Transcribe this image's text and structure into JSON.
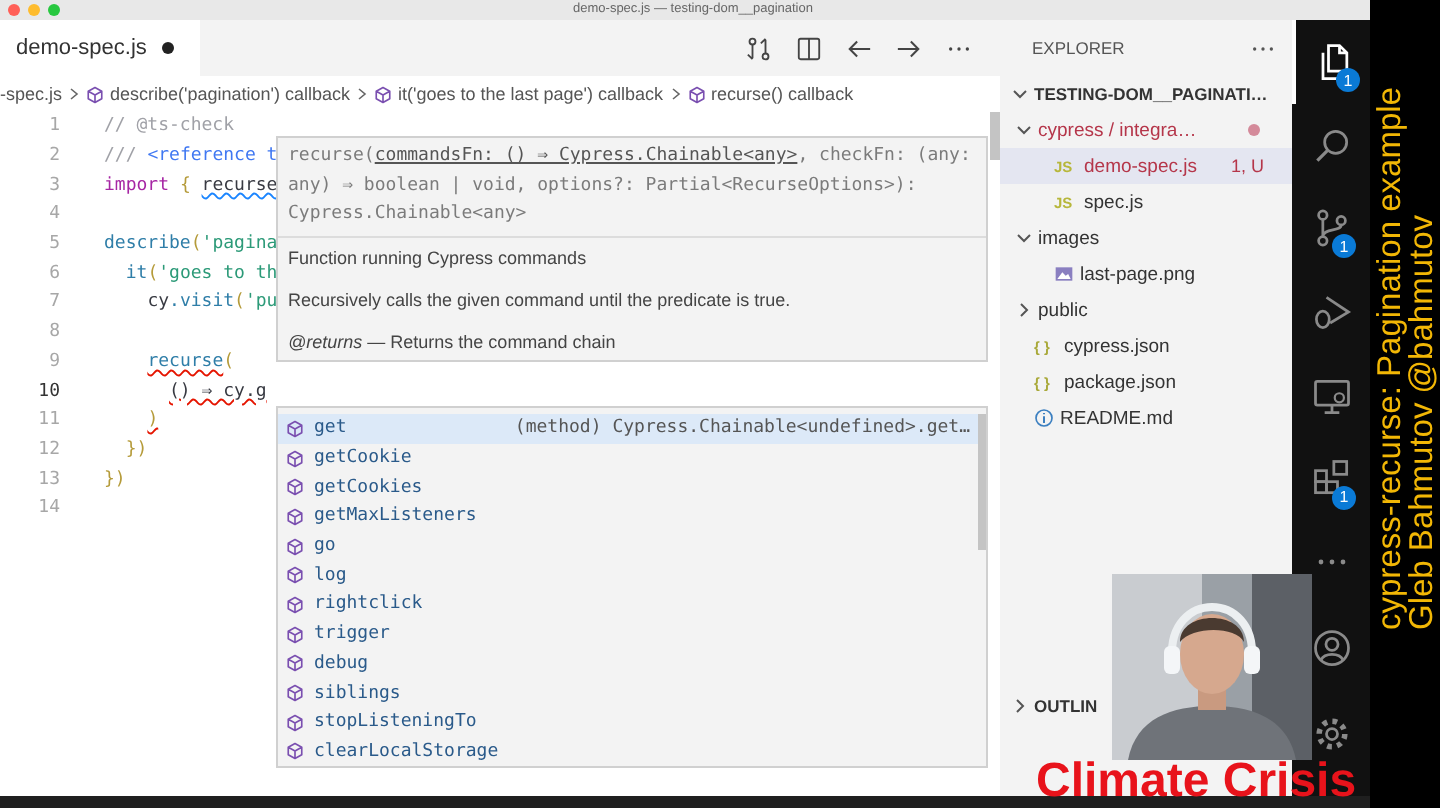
{
  "window": {
    "title": "demo-spec.js — testing-dom__pagination"
  },
  "editor": {
    "tabs": [
      {
        "label": "demo-spec.js",
        "selected": true,
        "dirty": true
      }
    ],
    "breadcrumbs": [
      {
        "label": "-spec.js",
        "kind": "file"
      },
      {
        "label": "describe('pagination') callback",
        "kind": "symbol"
      },
      {
        "label": "it('goes to the last page') callback",
        "kind": "symbol"
      },
      {
        "label": "recurse() callback",
        "kind": "symbol"
      }
    ],
    "lines": [
      {
        "number": "1",
        "current": false,
        "tokens": [
          {
            "text": "// @ts-check",
            "kind": "comment",
            "error": false,
            "hint": false
          }
        ]
      },
      {
        "number": "2",
        "current": false,
        "tokens": [
          {
            "text": "/// ",
            "kind": "comment",
            "error": false,
            "hint": false
          },
          {
            "text": "<reference t",
            "kind": "tag",
            "error": false,
            "hint": false
          }
        ]
      },
      {
        "number": "3",
        "current": false,
        "tokens": [
          {
            "text": "import",
            "kind": "keyword",
            "error": false,
            "hint": false
          },
          {
            "text": " { ",
            "kind": "punct",
            "error": false,
            "hint": false
          },
          {
            "text": "recurse",
            "kind": "variable",
            "error": false,
            "hint": true
          }
        ]
      },
      {
        "number": "4",
        "current": false
      },
      {
        "number": "5",
        "current": false,
        "tokens": [
          {
            "text": "describe",
            "kind": "function",
            "error": false,
            "hint": false
          },
          {
            "text": "(",
            "kind": "punct",
            "error": false,
            "hint": false
          },
          {
            "text": "'pagina",
            "kind": "string",
            "error": false,
            "hint": false
          }
        ]
      },
      {
        "number": "6",
        "current": false,
        "tokens": [
          {
            "text": "  it",
            "kind": "function",
            "error": false,
            "hint": false
          },
          {
            "text": "(",
            "kind": "punct",
            "error": false,
            "hint": false
          },
          {
            "text": "'goes to th",
            "kind": "string",
            "error": false,
            "hint": false
          }
        ]
      },
      {
        "number": "7",
        "current": false,
        "tokens": [
          {
            "text": "    cy",
            "kind": "plain",
            "error": false,
            "hint": false
          },
          {
            "text": ".visit",
            "kind": "function",
            "error": false,
            "hint": false
          },
          {
            "text": "(",
            "kind": "punct",
            "error": false,
            "hint": false
          },
          {
            "text": "'pu",
            "kind": "string",
            "error": false,
            "hint": false
          }
        ]
      },
      {
        "number": "8",
        "current": false
      },
      {
        "number": "9",
        "current": false,
        "tokens": [
          {
            "text": "    recurse",
            "kind": "function",
            "error": true,
            "hint": false
          },
          {
            "text": "(",
            "kind": "punct",
            "error": false,
            "hint": false
          }
        ]
      },
      {
        "number": "10",
        "current": true,
        "tokens": [
          {
            "text": "      () ⇒ cy.g",
            "kind": "plain",
            "error": true,
            "hint": false
          }
        ]
      },
      {
        "number": "11",
        "current": false,
        "tokens": [
          {
            "text": "    )",
            "kind": "punct",
            "error": true,
            "hint": false
          }
        ]
      },
      {
        "number": "12",
        "current": false,
        "tokens": [
          {
            "text": "  })",
            "kind": "punct",
            "error": false,
            "hint": false
          }
        ]
      },
      {
        "number": "13",
        "current": false,
        "tokens": [
          {
            "text": "})",
            "kind": "punct",
            "error": false,
            "hint": false
          }
        ]
      },
      {
        "number": "14",
        "current": false
      }
    ],
    "hover": {
      "signature": {
        "before": "recurse(",
        "active": "commandsFn: () ⇒ Cypress.Chainable<any>",
        "after": ", checkFn: (any: any) ⇒ boolean | void, options?: Partial<RecurseOptions>): Cypress.Chainable<any>"
      },
      "docs": [
        "Function running Cypress commands",
        "Recursively calls the given command until the predicate is true.",
        "*@returns* — Returns the command chain"
      ]
    },
    "suggest": {
      "items": [
        {
          "label": "get",
          "selected": true,
          "detail": "(method) Cypress.Chainable<undefined>.get…"
        },
        {
          "label": "getCookie",
          "selected": false
        },
        {
          "label": "getCookies",
          "selected": false
        },
        {
          "label": "getMaxListeners",
          "selected": false
        },
        {
          "label": "go",
          "selected": false
        },
        {
          "label": "log",
          "selected": false
        },
        {
          "label": "rightclick",
          "selected": false
        },
        {
          "label": "trigger",
          "selected": false
        },
        {
          "label": "debug",
          "selected": false
        },
        {
          "label": "siblings",
          "selected": false
        },
        {
          "label": "stopListeningTo",
          "selected": false
        },
        {
          "label": "clearLocalStorage",
          "selected": false
        }
      ]
    }
  },
  "explorer": {
    "title": "EXPLORER",
    "project": {
      "label": "TESTING-DOM__PAGINATI…",
      "expanded": true,
      "children": [
        {
          "label": "cypress / integra…",
          "kind": "folder",
          "expanded": true,
          "problem": true,
          "dot": true,
          "children": [
            {
              "label": "demo-spec.js",
              "kind": "js-file",
              "icon_text": "JS",
              "selected": true,
              "problem": true,
              "badge": "1, U"
            },
            {
              "label": "spec.js",
              "kind": "js-file",
              "icon_text": "JS",
              "selected": false,
              "problem": false
            }
          ]
        },
        {
          "label": "images",
          "kind": "folder",
          "expanded": true,
          "problem": false,
          "children": [
            {
              "label": "last-page.png",
              "kind": "image-file",
              "selected": false,
              "problem": false
            }
          ]
        },
        {
          "label": "public",
          "kind": "folder",
          "expanded": false,
          "problem": false
        },
        {
          "label": "cypress.json",
          "kind": "json-file",
          "icon_text": "{ }",
          "selected": false,
          "problem": false
        },
        {
          "label": "package.json",
          "kind": "json-file",
          "icon_text": "{ }",
          "selected": false,
          "problem": false
        },
        {
          "label": "README.md",
          "kind": "info-file",
          "selected": false,
          "problem": false
        }
      ]
    },
    "sections": [
      {
        "label": "OUTLIN",
        "expanded": false
      }
    ]
  },
  "activity_bar": {
    "items": [
      {
        "kind": "files",
        "selected": true,
        "badge": "1"
      },
      {
        "kind": "search",
        "selected": false
      },
      {
        "kind": "source-control",
        "selected": false,
        "badge": "1"
      },
      {
        "kind": "run-debug",
        "selected": false
      },
      {
        "kind": "remote",
        "selected": false
      },
      {
        "kind": "extensions",
        "selected": false,
        "badge": "1"
      },
      {
        "kind": "more",
        "selected": false
      }
    ],
    "bottom_items": [
      {
        "kind": "account"
      },
      {
        "kind": "settings"
      }
    ]
  },
  "overlay": {
    "caption_lines": [
      "cypress-recurse: Pagination example",
      "Gleb Bahmutov @bahmutov"
    ],
    "banner": "Climate Crisis"
  }
}
